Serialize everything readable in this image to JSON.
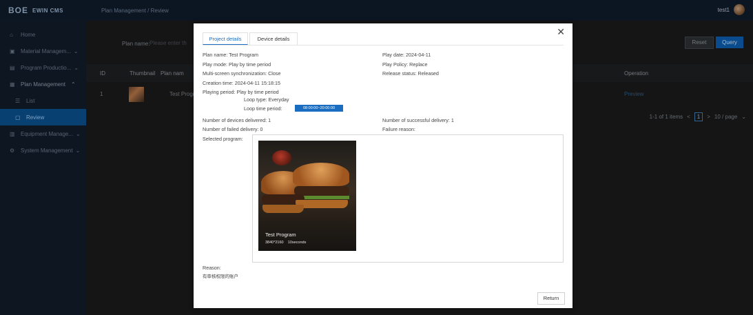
{
  "app": {
    "logo_text": "BOE",
    "logo_sub": "EWIN CMS",
    "breadcrumb": "Plan Management / Review",
    "user_name": "test1"
  },
  "sidebar": {
    "items": [
      {
        "label": "Home",
        "icon": "home-icon"
      },
      {
        "label": "Material Managem...",
        "icon": "image-icon"
      },
      {
        "label": "Program Productio...",
        "icon": "film-icon"
      },
      {
        "label": "Plan Management",
        "icon": "calendar-icon"
      },
      {
        "label": "List",
        "icon": "list-icon"
      },
      {
        "label": "Review",
        "icon": "review-icon"
      },
      {
        "label": "Equipment Manage...",
        "icon": "device-icon"
      },
      {
        "label": "System Management",
        "icon": "gear-icon"
      }
    ],
    "active_item": "Review"
  },
  "search": {
    "plan_name_label": "Plan name:",
    "plan_name_placeholder": "Please enter th",
    "reset_label": "Reset",
    "query_label": "Query"
  },
  "table": {
    "headers": [
      "ID",
      "Thumbnail",
      "Plan nam",
      "Operation"
    ],
    "rows": [
      {
        "id": "1",
        "plan_name": "Test Progr",
        "operation": "Preview"
      }
    ]
  },
  "pagination": {
    "summary": "1-1 of 1 items",
    "prev": "<",
    "page": "1",
    "next": ">",
    "page_size": "10 / page"
  },
  "modal": {
    "close_icon": "close-icon",
    "tabs": [
      "Project details",
      "Device details"
    ],
    "active_tab": "Project details",
    "fields": {
      "plan_name": "Plan name:  Test Program",
      "play_date": "Play date:  2024-04-11",
      "play_mode": "Play mode:  Play by time period",
      "play_policy": "Play Policy:  Replace",
      "multi_screen": "Multi-screen synchronization:  Close",
      "release_status": "Release status:  Released",
      "creation_time": "Creation time:  2024-04-11 15:18:15",
      "playing_period": "Playing period:  Play by time period",
      "loop_type": "Loop type:  Everyday",
      "loop_time_label": "Loop time period:",
      "loop_time_value": "08:00:00~20:00:00",
      "devices_delivered": "Number of devices delivered:  1",
      "successful_delivery": "Number of successful delivery:  1",
      "failed_delivery": "Number of failed delivery:  0",
      "failure_reason": "Failure reason:",
      "selected_program": "Selected program:"
    },
    "program": {
      "title": "Test Program",
      "resolution": "3840*2160",
      "duration": "10seconds"
    },
    "reason_label": "Reason:",
    "reason_text": "有审核权限的账户",
    "return_label": "Return"
  }
}
